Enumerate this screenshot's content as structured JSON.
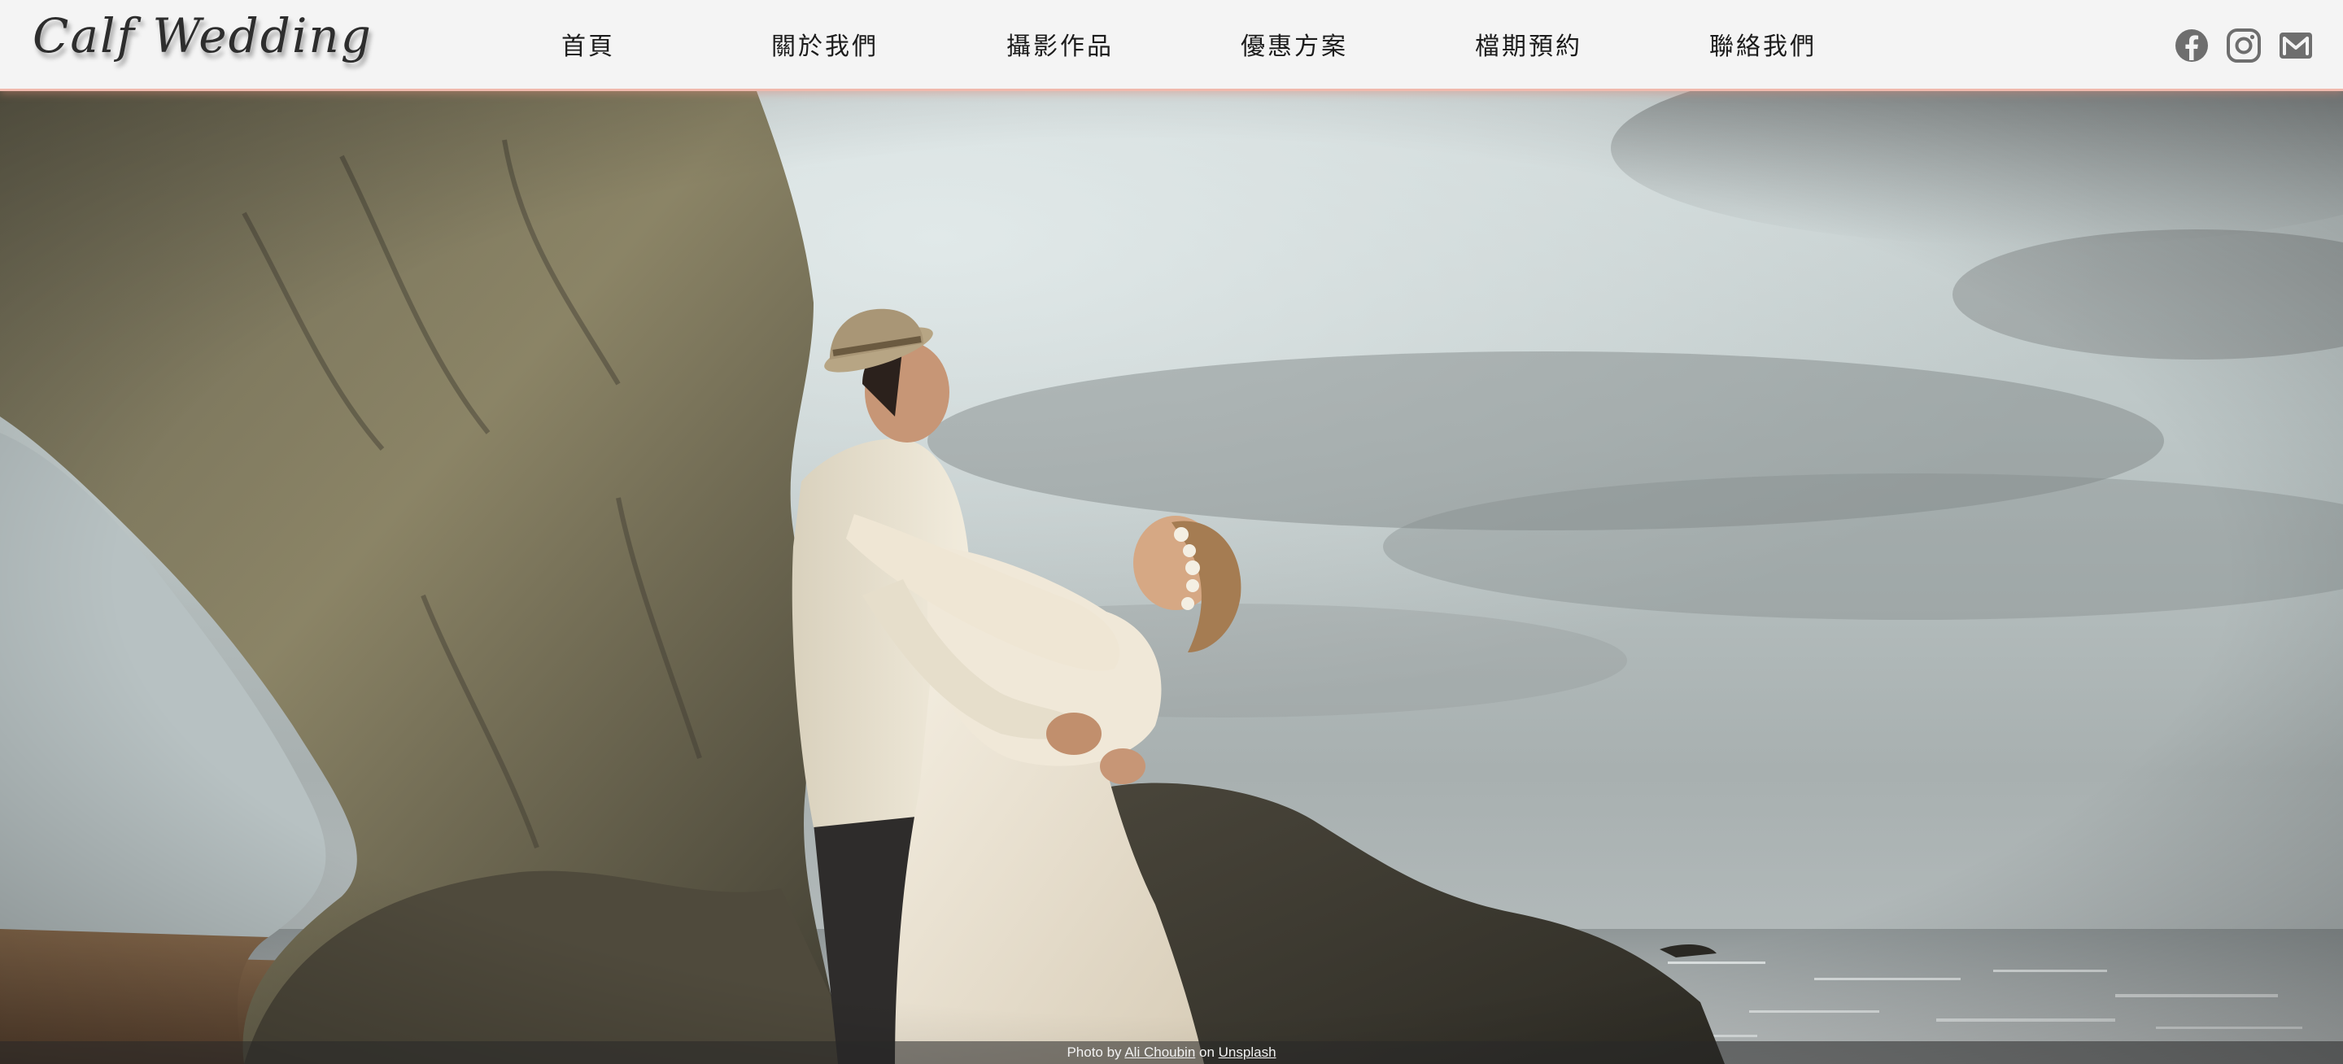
{
  "brand": {
    "logo_text": "Calf Wedding"
  },
  "nav": {
    "items": [
      {
        "label": "首頁"
      },
      {
        "label": "關於我們"
      },
      {
        "label": "攝影作品"
      },
      {
        "label": "優惠方案"
      },
      {
        "label": "檔期預約"
      },
      {
        "label": "聯絡我們"
      }
    ]
  },
  "social": {
    "icons": [
      "facebook-icon",
      "instagram-icon",
      "mail-icon"
    ],
    "icon_color": "#6e6e6e"
  },
  "hero": {
    "image_subject": "couple-on-beach-photo",
    "credit": {
      "prefix": "Photo by ",
      "author": "Ali Choubin",
      "middle": " on ",
      "source": "Unsplash"
    }
  },
  "colors": {
    "header_bg": "#f4f4f4",
    "header_accent": "#f0b9ad",
    "nav_text": "#1c1c1c"
  }
}
